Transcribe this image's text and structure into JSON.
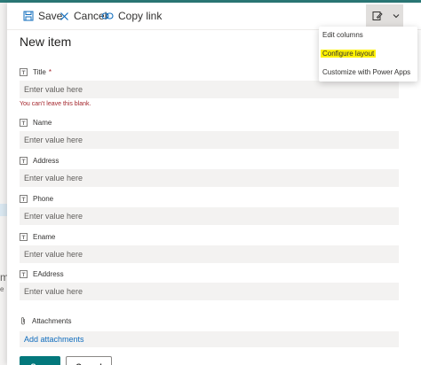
{
  "toolbar": {
    "save_label": "Save",
    "cancel_label": "Cancel",
    "copy_link_label": "Copy link"
  },
  "form": {
    "title": "New item",
    "required_marker": "*",
    "error_message": "You can't leave this blank.",
    "fields": [
      {
        "label": "Title",
        "placeholder": "Enter value here",
        "required": true
      },
      {
        "label": "Name",
        "placeholder": "Enter value here"
      },
      {
        "label": "Address",
        "placeholder": "Enter value here"
      },
      {
        "label": "Phone",
        "placeholder": "Enter value here"
      },
      {
        "label": "Ename",
        "placeholder": "Enter value here"
      },
      {
        "label": "EAddress",
        "placeholder": "Enter value here"
      }
    ],
    "attachments": {
      "label": "Attachments",
      "link": "Add attachments"
    },
    "buttons": {
      "save": "Save",
      "cancel": "Cancel"
    }
  },
  "layout_menu": {
    "items": [
      {
        "label": "Edit columns"
      },
      {
        "label": "Configure layout",
        "highlighted": true,
        "highlight_color": "#fff200"
      },
      {
        "label": "Customize with Power Apps"
      }
    ]
  },
  "background": {
    "fragments": [
      "m",
      "e"
    ]
  },
  "colors": {
    "accent": "#03787c",
    "error": "#a4262c",
    "link": "#0f6cbd",
    "top_bar": "#2b7a78"
  }
}
